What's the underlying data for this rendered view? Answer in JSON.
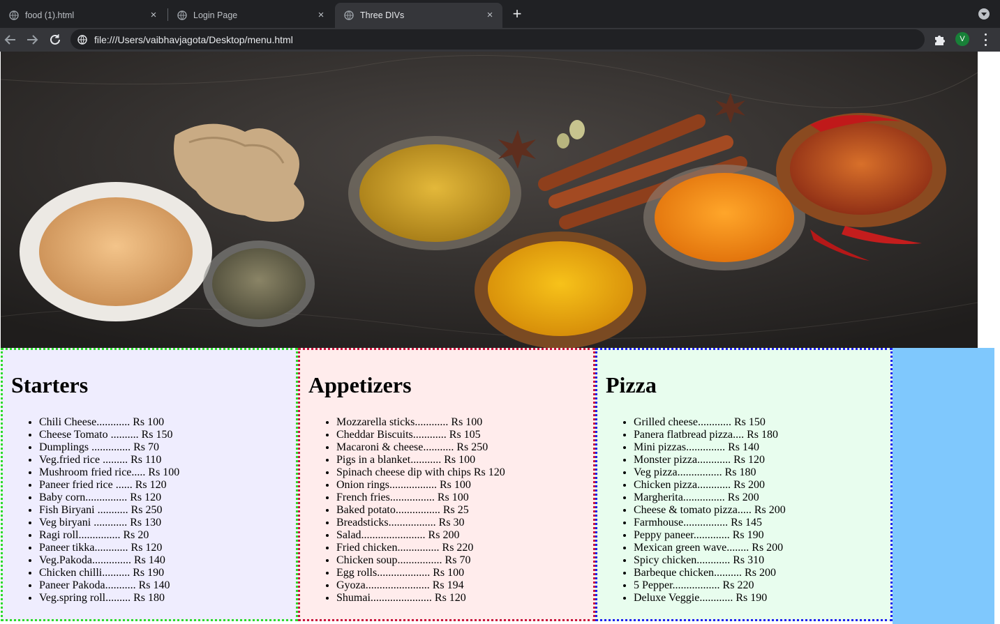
{
  "browser": {
    "tabs": [
      {
        "title": "food (1).html",
        "close": "×"
      },
      {
        "title": "Login Page",
        "close": "×"
      },
      {
        "title": "Three DIVs",
        "close": "×"
      }
    ],
    "new_tab": "+",
    "url": "file:///Users/vaibhavjagota/Desktop/menu.html",
    "profile_initial": "V"
  },
  "page": {
    "hero_image": "spices-banner-image",
    "sections": [
      {
        "heading": "Starters",
        "items": [
          "Chili Cheese............ Rs 100",
          "Cheese Tomato .......... Rs 150",
          "Dumplings .............. Rs 70",
          "Veg.fried rice ......... Rs 110",
          "Mushroom fried rice..... Rs 100",
          "Paneer fried rice ...... Rs 120",
          "Baby corn............... Rs 120",
          "Fish Biryani ........... Rs 250",
          "Veg biryani ............ Rs 130",
          "Ragi roll............... Rs 20",
          "Paneer tikka............ Rs 120",
          "Veg.Pakoda.............. Rs 140",
          "Chicken chilli.......... Rs 190",
          "Paneer Pakoda........... Rs 140",
          "Veg.spring roll......... Rs 180"
        ]
      },
      {
        "heading": "Appetizers",
        "items": [
          "Mozzarella sticks............ Rs 100",
          "Cheddar Biscuits............ Rs 105",
          "Macaroni & cheese........... Rs 250",
          "Pigs in a blanket........... Rs 100",
          "Spinach cheese dip with chips Rs 120",
          "Onion rings................. Rs 100",
          "French fries................ Rs 100",
          "Baked potato................ Rs 25",
          "Breadsticks................. Rs 30",
          "Salad....................... Rs 200",
          "Fried chicken............... Rs 220",
          "Chicken soup................ Rs 70",
          "Egg rolls................... Rs 100",
          "Gyoza....................... Rs 194",
          "Shumai...................... Rs 120"
        ]
      },
      {
        "heading": "Pizza",
        "items": [
          "Grilled cheese............ Rs 150",
          "Panera flatbread pizza.... Rs 180",
          "Mini pizzas.............. Rs 140",
          "Monster pizza............ Rs 120",
          "Veg pizza................ Rs 180",
          "Chicken pizza............ Rs 200",
          "Margherita............... Rs 200",
          "Cheese & tomato pizza..... Rs 200",
          "Farmhouse................ Rs 145",
          "Peppy paneer............. Rs 190",
          "Mexican green wave........ Rs 200",
          "Spicy chicken............ Rs 310",
          "Barbeque chicken.......... Rs 200",
          "5 Pepper................. Rs 220",
          "Deluxe Veggie............ Rs 190"
        ]
      }
    ]
  }
}
